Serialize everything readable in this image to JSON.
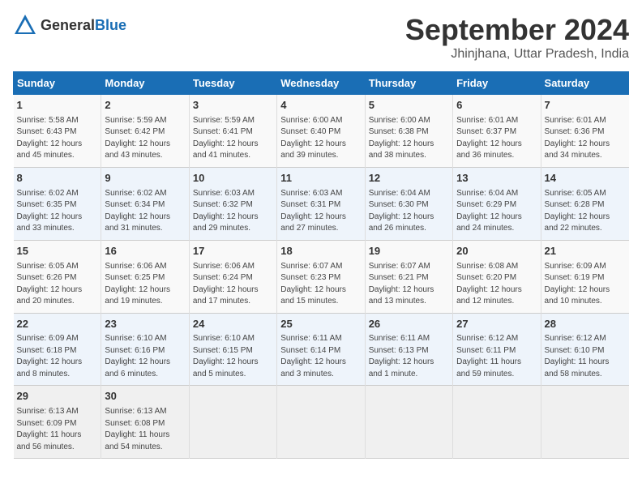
{
  "header": {
    "logo_general": "General",
    "logo_blue": "Blue",
    "month": "September 2024",
    "location": "Jhinjhana, Uttar Pradesh, India"
  },
  "days_of_week": [
    "Sunday",
    "Monday",
    "Tuesday",
    "Wednesday",
    "Thursday",
    "Friday",
    "Saturday"
  ],
  "weeks": [
    [
      {
        "day": "1",
        "info": "Sunrise: 5:58 AM\nSunset: 6:43 PM\nDaylight: 12 hours\nand 45 minutes."
      },
      {
        "day": "2",
        "info": "Sunrise: 5:59 AM\nSunset: 6:42 PM\nDaylight: 12 hours\nand 43 minutes."
      },
      {
        "day": "3",
        "info": "Sunrise: 5:59 AM\nSunset: 6:41 PM\nDaylight: 12 hours\nand 41 minutes."
      },
      {
        "day": "4",
        "info": "Sunrise: 6:00 AM\nSunset: 6:40 PM\nDaylight: 12 hours\nand 39 minutes."
      },
      {
        "day": "5",
        "info": "Sunrise: 6:00 AM\nSunset: 6:38 PM\nDaylight: 12 hours\nand 38 minutes."
      },
      {
        "day": "6",
        "info": "Sunrise: 6:01 AM\nSunset: 6:37 PM\nDaylight: 12 hours\nand 36 minutes."
      },
      {
        "day": "7",
        "info": "Sunrise: 6:01 AM\nSunset: 6:36 PM\nDaylight: 12 hours\nand 34 minutes."
      }
    ],
    [
      {
        "day": "8",
        "info": "Sunrise: 6:02 AM\nSunset: 6:35 PM\nDaylight: 12 hours\nand 33 minutes."
      },
      {
        "day": "9",
        "info": "Sunrise: 6:02 AM\nSunset: 6:34 PM\nDaylight: 12 hours\nand 31 minutes."
      },
      {
        "day": "10",
        "info": "Sunrise: 6:03 AM\nSunset: 6:32 PM\nDaylight: 12 hours\nand 29 minutes."
      },
      {
        "day": "11",
        "info": "Sunrise: 6:03 AM\nSunset: 6:31 PM\nDaylight: 12 hours\nand 27 minutes."
      },
      {
        "day": "12",
        "info": "Sunrise: 6:04 AM\nSunset: 6:30 PM\nDaylight: 12 hours\nand 26 minutes."
      },
      {
        "day": "13",
        "info": "Sunrise: 6:04 AM\nSunset: 6:29 PM\nDaylight: 12 hours\nand 24 minutes."
      },
      {
        "day": "14",
        "info": "Sunrise: 6:05 AM\nSunset: 6:28 PM\nDaylight: 12 hours\nand 22 minutes."
      }
    ],
    [
      {
        "day": "15",
        "info": "Sunrise: 6:05 AM\nSunset: 6:26 PM\nDaylight: 12 hours\nand 20 minutes."
      },
      {
        "day": "16",
        "info": "Sunrise: 6:06 AM\nSunset: 6:25 PM\nDaylight: 12 hours\nand 19 minutes."
      },
      {
        "day": "17",
        "info": "Sunrise: 6:06 AM\nSunset: 6:24 PM\nDaylight: 12 hours\nand 17 minutes."
      },
      {
        "day": "18",
        "info": "Sunrise: 6:07 AM\nSunset: 6:23 PM\nDaylight: 12 hours\nand 15 minutes."
      },
      {
        "day": "19",
        "info": "Sunrise: 6:07 AM\nSunset: 6:21 PM\nDaylight: 12 hours\nand 13 minutes."
      },
      {
        "day": "20",
        "info": "Sunrise: 6:08 AM\nSunset: 6:20 PM\nDaylight: 12 hours\nand 12 minutes."
      },
      {
        "day": "21",
        "info": "Sunrise: 6:09 AM\nSunset: 6:19 PM\nDaylight: 12 hours\nand 10 minutes."
      }
    ],
    [
      {
        "day": "22",
        "info": "Sunrise: 6:09 AM\nSunset: 6:18 PM\nDaylight: 12 hours\nand 8 minutes."
      },
      {
        "day": "23",
        "info": "Sunrise: 6:10 AM\nSunset: 6:16 PM\nDaylight: 12 hours\nand 6 minutes."
      },
      {
        "day": "24",
        "info": "Sunrise: 6:10 AM\nSunset: 6:15 PM\nDaylight: 12 hours\nand 5 minutes."
      },
      {
        "day": "25",
        "info": "Sunrise: 6:11 AM\nSunset: 6:14 PM\nDaylight: 12 hours\nand 3 minutes."
      },
      {
        "day": "26",
        "info": "Sunrise: 6:11 AM\nSunset: 6:13 PM\nDaylight: 12 hours\nand 1 minute."
      },
      {
        "day": "27",
        "info": "Sunrise: 6:12 AM\nSunset: 6:11 PM\nDaylight: 11 hours\nand 59 minutes."
      },
      {
        "day": "28",
        "info": "Sunrise: 6:12 AM\nSunset: 6:10 PM\nDaylight: 11 hours\nand 58 minutes."
      }
    ],
    [
      {
        "day": "29",
        "info": "Sunrise: 6:13 AM\nSunset: 6:09 PM\nDaylight: 11 hours\nand 56 minutes."
      },
      {
        "day": "30",
        "info": "Sunrise: 6:13 AM\nSunset: 6:08 PM\nDaylight: 11 hours\nand 54 minutes."
      },
      {
        "day": "",
        "info": ""
      },
      {
        "day": "",
        "info": ""
      },
      {
        "day": "",
        "info": ""
      },
      {
        "day": "",
        "info": ""
      },
      {
        "day": "",
        "info": ""
      }
    ]
  ]
}
